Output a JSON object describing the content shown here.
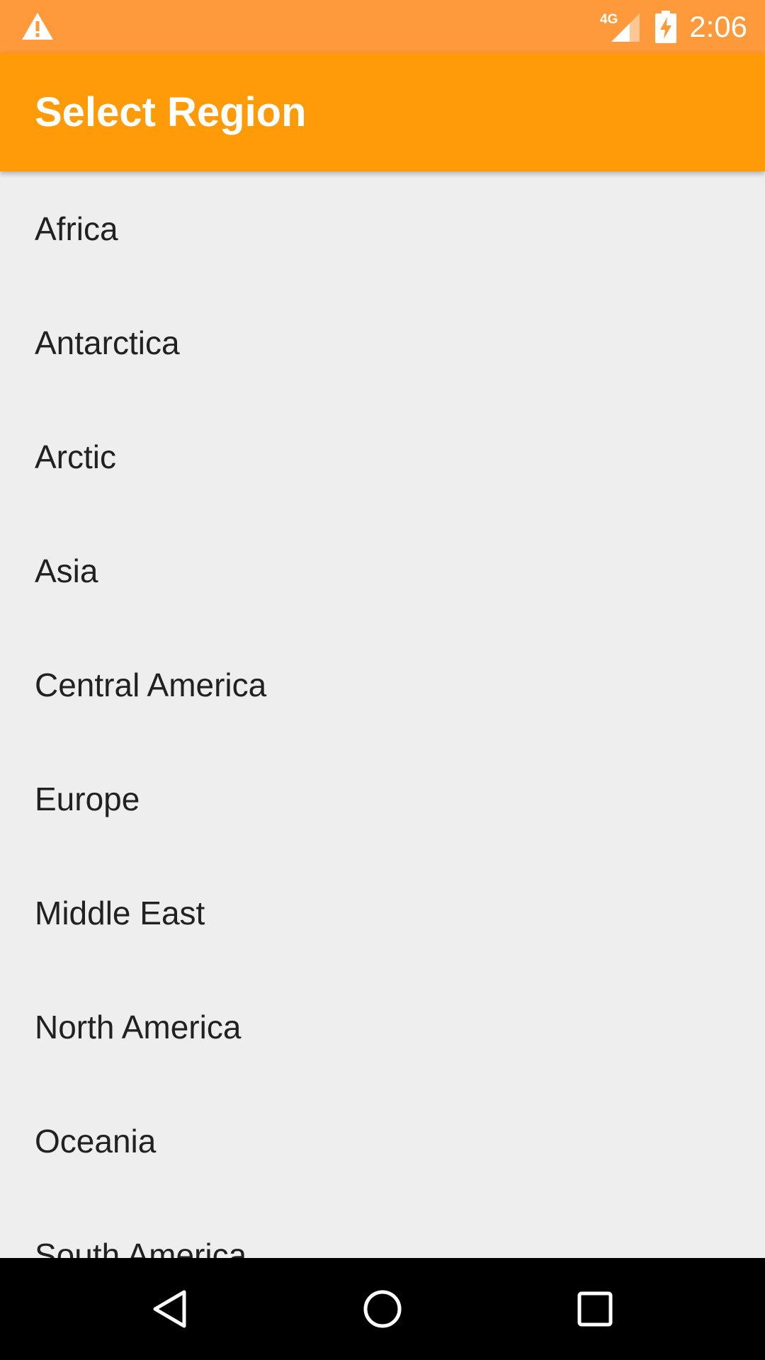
{
  "status_bar": {
    "time": "2:06",
    "network_label": "4G",
    "icons": [
      "warning-icon",
      "signal-4g-icon",
      "battery-charging-icon"
    ],
    "background_color": "#ff9a3c"
  },
  "app_bar": {
    "title": "Select Region",
    "background_color": "#ff9a09"
  },
  "regions": [
    "Africa",
    "Antarctica",
    "Arctic",
    "Asia",
    "Central America",
    "Europe",
    "Middle East",
    "North America",
    "Oceania",
    "South America"
  ],
  "nav_bar": {
    "buttons": [
      "back-icon",
      "home-icon",
      "recents-icon"
    ]
  }
}
